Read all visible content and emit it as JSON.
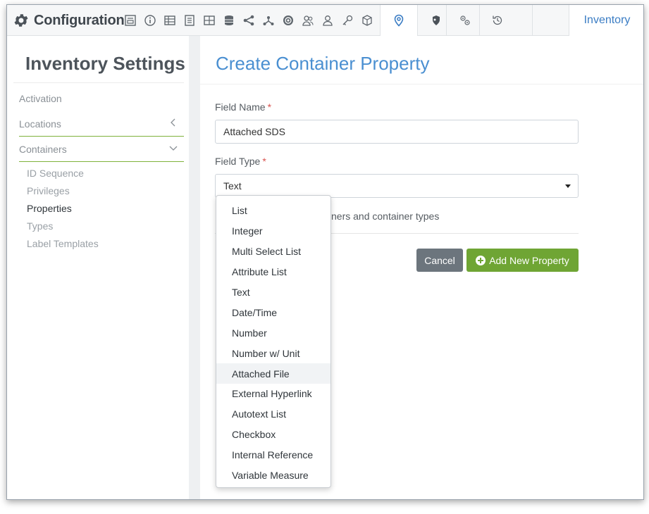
{
  "toolbar": {
    "title": "Configuration",
    "icons": [
      "gear-icon",
      "form-icon",
      "info-icon",
      "table-icon",
      "list-icon",
      "grid-icon",
      "database-icon",
      "share-icon",
      "network-icon",
      "badge-icon",
      "users-icon",
      "user-icon",
      "key-icon",
      "cube-icon",
      "location-icon",
      "shield-icon",
      "cogs-icon",
      "history-icon"
    ],
    "active_tab": "Inventory",
    "accent_color": "#3b7dc4"
  },
  "sidebar": {
    "title": "Inventory Settings",
    "items": [
      {
        "label": "Activation"
      },
      {
        "label": "Locations"
      },
      {
        "label": "Containers"
      }
    ],
    "sub_items": [
      {
        "label": "ID Sequence"
      },
      {
        "label": "Privileges"
      },
      {
        "label": "Properties"
      },
      {
        "label": "Types"
      },
      {
        "label": "Label Templates"
      }
    ],
    "accent_color": "#7fb23b"
  },
  "form": {
    "title": "Create Container Property",
    "field_name_label": "Field Name",
    "required_mark": "*",
    "field_name_value": "Attached SDS",
    "field_type_label": "Field Type",
    "field_type_value": "Text",
    "help_text_partial": "ners and container types",
    "cancel_label": "Cancel",
    "add_label": "Add New Property"
  },
  "dropdown": {
    "options": [
      "List",
      "Integer",
      "Multi Select List",
      "Attribute List",
      "Text",
      "Date/Time",
      "Number",
      "Number w/ Unit",
      "Attached File",
      "External Hyperlink",
      "Autotext List",
      "Checkbox",
      "Internal Reference",
      "Variable Measure"
    ],
    "hovered": "Attached File"
  }
}
